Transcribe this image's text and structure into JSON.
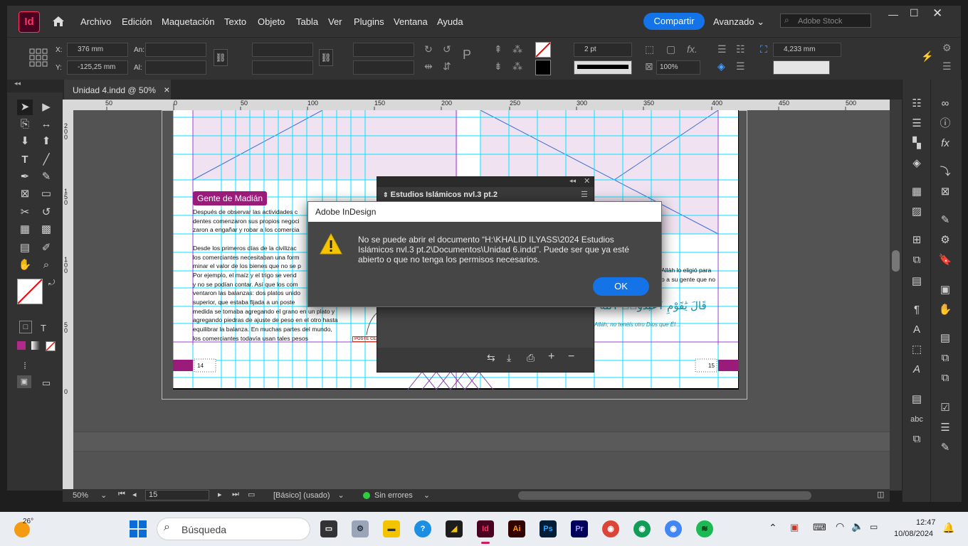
{
  "menubar": {
    "app_icon": "Id",
    "menus": [
      "Archivo",
      "Edición",
      "Maquetación",
      "Texto",
      "Objeto",
      "Tabla",
      "Ver",
      "Plugins",
      "Ventana",
      "Ayuda"
    ],
    "share_label": "Compartir",
    "workspace": "Avanzado",
    "stock_placeholder": "Adobe Stock"
  },
  "controlbar": {
    "x_label": "X:",
    "x_value": "376 mm",
    "y_label": "Y:",
    "y_value": "-125,25 mm",
    "w_label": "An:",
    "h_label": "Al:",
    "stroke_weight": "2 pt",
    "opacity": "100%",
    "gap_value": "4,233 mm"
  },
  "tab": {
    "title": "Unidad 4.indd @ 50%",
    "close": "×"
  },
  "ruler": {
    "h_ticks": [
      "50",
      "0",
      "50",
      "100",
      "150",
      "200",
      "250",
      "300",
      "350",
      "400",
      "450",
      "500"
    ],
    "v_ticks": [
      "200",
      "150",
      "100",
      "50",
      "0"
    ]
  },
  "page": {
    "heading": "Gente de Madián",
    "col_lines": [
      "Después de observar las actividades c",
      "dentes comenzaron sus propios negoci",
      "zaron a engañar y robar a los comercia",
      "",
      "Desde los primeros días de la civilizac",
      "los comerciantes necesitaban una form",
      "minar el valor de los bienes que no se p",
      "Por ejemplo, el maíz y el trigo se vend",
      "y no se podían contar. Así que los com",
      "ventaron las balanzas: dos platos unido",
      "superior, que estaba fijada a un poste",
      "medida se tomaba agregando el grano en un plato y",
      "agregando piedras de ajuste de peso en el otro hasta",
      "equilibrar la balanza. En muchas partes del mundo,",
      "los comerciantes todavía usan tales pesos"
    ],
    "right_line1": "Alláh lo eligió para",
    "right_line2": "o a su gente que no",
    "arabic": "قَالَ يَٰقَوْمِ ٱعْبُدُوا۟ ٱللَّهَ مَ",
    "translation": "Alláh; no tenéis otro Dios que Él...",
    "poster": "POSTE CEN",
    "page_left": "14",
    "page_right": "15"
  },
  "float_panel": {
    "title": "Estudios Islámicos nvl.3 pt.2"
  },
  "dialog": {
    "title": "Adobe InDesign",
    "message": "No se puede abrir el documento “H:\\KHALID ILYASS\\2024 Estudios Islámicos nvl.3 pt.2\\Documentos\\Unidad 6.indd”. Puede ser que ya esté abierto o que no tenga los permisos necesarios.",
    "ok": "OK"
  },
  "status": {
    "zoom": "50%",
    "page": "15",
    "master": "[Básico] (usado)",
    "preflight": "Sin errores"
  },
  "taskbar": {
    "weather": "26°",
    "search": "Búsqueda",
    "time": "12:47",
    "date": "10/08/2024"
  },
  "colors": {
    "accent": "#1473e6",
    "magenta": "#9b1b7b",
    "guide": "#00e5ff",
    "warning": "#f5c400"
  }
}
